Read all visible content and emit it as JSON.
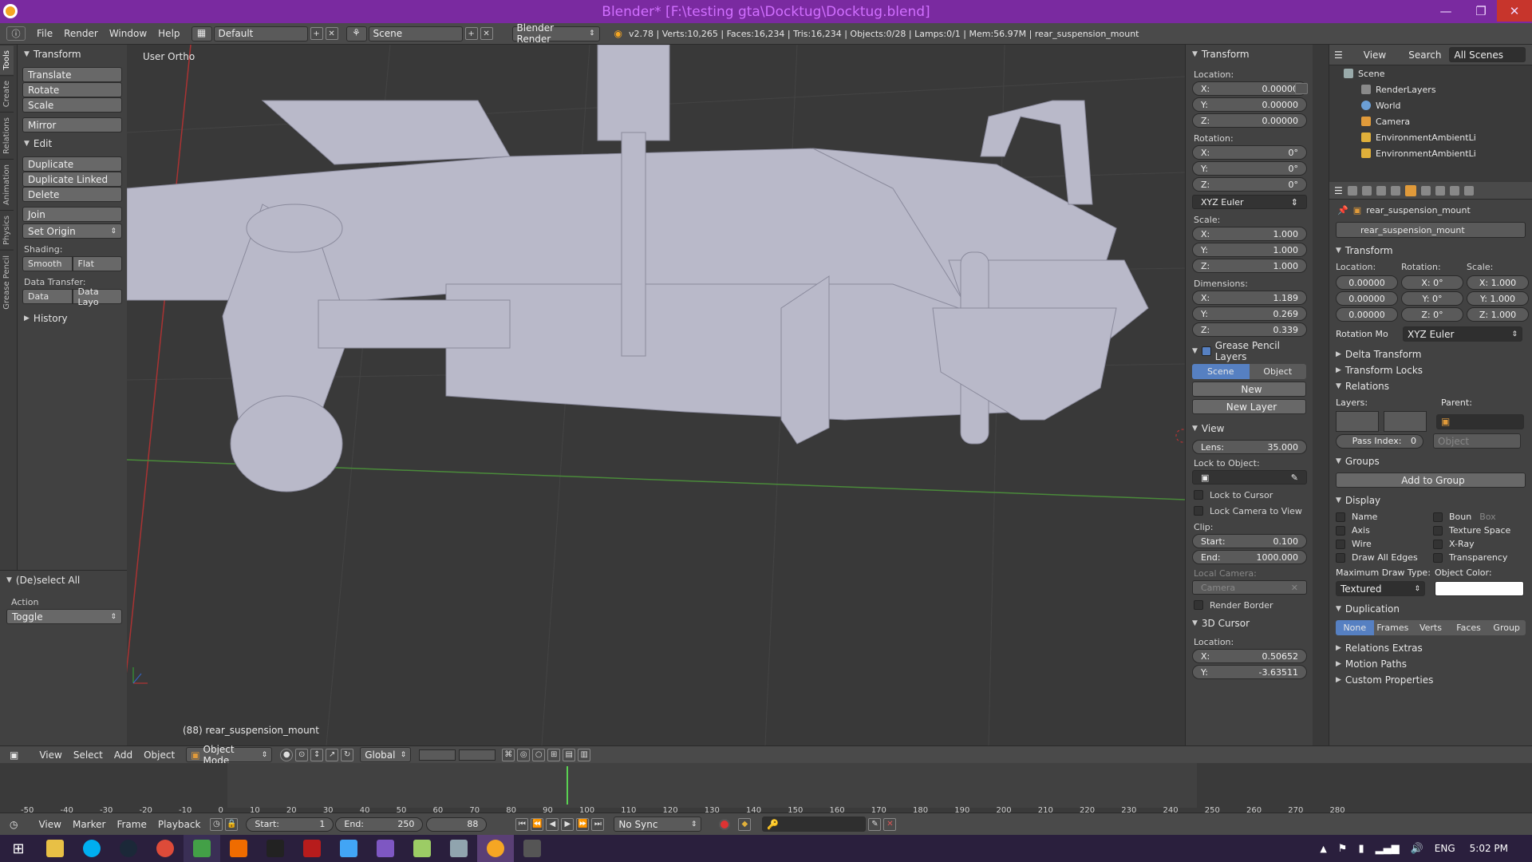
{
  "title": "Blender* [F:\\testing gta\\Docktug\\Docktug.blend]",
  "menu": {
    "file": "File",
    "render": "Render",
    "window": "Window",
    "help": "Help",
    "layout": "Default",
    "scene": "Scene",
    "engine": "Blender Render",
    "stats": "v2.78 | Verts:10,265 | Faces:16,234 | Tris:16,234 | Objects:0/28 | Lamps:0/1 | Mem:56.97M | rear_suspension_mount"
  },
  "tabs": [
    "Tools",
    "Create",
    "Relations",
    "Animation",
    "Physics",
    "Grease Pencil"
  ],
  "tools": {
    "transform_head": "Transform",
    "translate": "Translate",
    "rotate": "Rotate",
    "scale": "Scale",
    "mirror": "Mirror",
    "edit_head": "Edit",
    "duplicate": "Duplicate",
    "duplicate_linked": "Duplicate Linked",
    "delete": "Delete",
    "join": "Join",
    "set_origin": "Set Origin",
    "shading": "Shading:",
    "smooth": "Smooth",
    "flat": "Flat",
    "data_transfer": "Data Transfer:",
    "data": "Data",
    "data_layo": "Data Layo",
    "history": "History"
  },
  "redo": {
    "head": "(De)select All",
    "action": "Action",
    "toggle": "Toggle"
  },
  "viewport": {
    "view_name": "User Ortho",
    "object_label": "(88) rear_suspension_mount"
  },
  "npanel": {
    "transform": "Transform",
    "location": "Location:",
    "loc": [
      "0.00000",
      "0.00000",
      "0.00000"
    ],
    "rotation": "Rotation:",
    "rot": [
      "0°",
      "0°",
      "0°"
    ],
    "euler": "XYZ Euler",
    "scale": "Scale:",
    "scl": [
      "1.000",
      "1.000",
      "1.000"
    ],
    "dimensions": "Dimensions:",
    "dim": [
      "1.189",
      "0.269",
      "0.339"
    ],
    "axes": [
      "X:",
      "Y:",
      "Z:"
    ],
    "gp_head": "Grease Pencil Layers",
    "scene_btn": "Scene",
    "object_btn": "Object",
    "new": "New",
    "new_layer": "New Layer",
    "view_head": "View",
    "lens": "Lens:",
    "lens_val": "35.000",
    "lock_obj": "Lock to Object:",
    "lock_cursor": "Lock to Cursor",
    "lock_cam": "Lock Camera to View",
    "clip": "Clip:",
    "start": "Start:",
    "start_val": "0.100",
    "end": "End:",
    "end_val": "1000.000",
    "local_cam": "Local Camera:",
    "camera": "Camera",
    "render_border": "Render Border",
    "cursor_head": "3D Cursor",
    "cursor_loc": "Location:",
    "cx": "0.50652",
    "cy": "-3.63511"
  },
  "outliner": {
    "view": "View",
    "search": "Search",
    "all_scenes": "All Scenes",
    "items": [
      "Scene",
      "RenderLayers",
      "World",
      "Camera",
      "EnvironmentAmbientLi",
      "EnvironmentAmbientLi"
    ]
  },
  "props": {
    "obj_name": "rear_suspension_mount",
    "obj_field": "rear_suspension_mount",
    "transform": "Transform",
    "location": "Location:",
    "rotation": "Rotation:",
    "scale": "Scale:",
    "loc": [
      "0.00000",
      "0.00000",
      "0.00000"
    ],
    "rot": [
      "X: 0°",
      "Y: 0°",
      "Z: 0°"
    ],
    "scl": [
      "X: 1.000",
      "Y: 1.000",
      "Z: 1.000"
    ],
    "rot_mode": "Rotation Mo",
    "rot_val": "XYZ Euler",
    "delta": "Delta Transform",
    "locks": "Transform Locks",
    "relations": "Relations",
    "layers": "Layers:",
    "parent": "Parent:",
    "object": "Object",
    "pass_index": "Pass Index:",
    "pass_val": "0",
    "groups": "Groups",
    "add_group": "Add to Group",
    "display": "Display",
    "name": "Name",
    "axis": "Axis",
    "wire": "Wire",
    "draw_all": "Draw All Edges",
    "bounds": "Boun",
    "box": "Box",
    "tex_space": "Texture Space",
    "xray": "X-Ray",
    "transparency": "Transparency",
    "max_draw": "Maximum Draw Type:",
    "obj_color": "Object Color:",
    "textured": "Textured",
    "duplication": "Duplication",
    "dup_modes": [
      "None",
      "Frames",
      "Verts",
      "Faces",
      "Group"
    ],
    "rel_extras": "Relations Extras",
    "motion_paths": "Motion Paths",
    "custom_props": "Custom Properties"
  },
  "vheader": {
    "view": "View",
    "select": "Select",
    "add": "Add",
    "object": "Object",
    "mode": "Object Mode",
    "global": "Global"
  },
  "timeline": {
    "ticks": [
      "-50",
      "-40",
      "-30",
      "-20",
      "-10",
      "0",
      "10",
      "20",
      "30",
      "40",
      "50",
      "60",
      "70",
      "80",
      "90",
      "100",
      "110",
      "120",
      "130",
      "140",
      "150",
      "160",
      "170",
      "180",
      "190",
      "200",
      "210",
      "220",
      "230",
      "240",
      "250",
      "260",
      "270",
      "280"
    ],
    "view": "View",
    "marker": "Marker",
    "frame": "Frame",
    "playback": "Playback",
    "start": "Start:",
    "start_val": "1",
    "end": "End:",
    "end_val": "250",
    "current": "88",
    "sync": "No Sync"
  },
  "taskbar": {
    "lang": "ENG",
    "time": "5:02 PM"
  }
}
